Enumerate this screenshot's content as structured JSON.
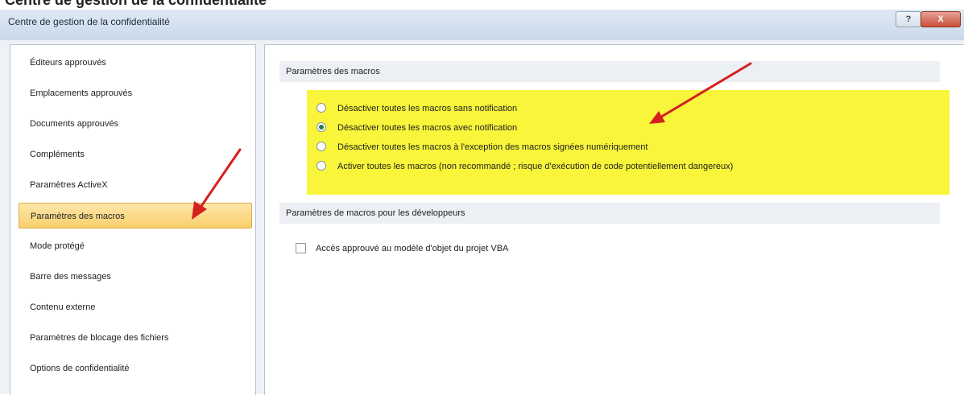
{
  "window": {
    "title": "Centre de gestion de la confidentialité",
    "buttons": {
      "help_symbol": "?",
      "close_symbol": "X"
    }
  },
  "sidebar": {
    "items": [
      {
        "label": "Éditeurs approuvés"
      },
      {
        "label": "Emplacements approuvés"
      },
      {
        "label": "Documents approuvés"
      },
      {
        "label": "Compléments"
      },
      {
        "label": "Paramètres ActiveX"
      },
      {
        "label": "Paramètres des macros",
        "selected": true
      },
      {
        "label": "Mode protégé"
      },
      {
        "label": "Barre des messages"
      },
      {
        "label": "Contenu externe"
      },
      {
        "label": "Paramètres de blocage des fichiers"
      },
      {
        "label": "Options de confidentialité"
      }
    ]
  },
  "main": {
    "macro_settings": {
      "header": "Paramètres des macros",
      "options": [
        {
          "label": "Désactiver toutes les macros sans notification",
          "checked": false
        },
        {
          "label": "Désactiver toutes les macros avec notification",
          "checked": true
        },
        {
          "label": "Désactiver toutes les macros à l'exception des macros signées numériquement",
          "checked": false
        },
        {
          "label": "Activer toutes les macros (non recommandé ; risque d'exécution de code potentiellement dangereux)",
          "checked": false
        }
      ]
    },
    "developer_settings": {
      "header": "Paramètres de macros pour les développeurs",
      "vba_access": {
        "label": "Accès approuvé au modèle d'objet du projet VBA",
        "checked": false
      }
    }
  },
  "colors": {
    "highlight": "#f8f53a",
    "selection": "#f9cf6d",
    "annotation_arrow": "#d62020"
  }
}
